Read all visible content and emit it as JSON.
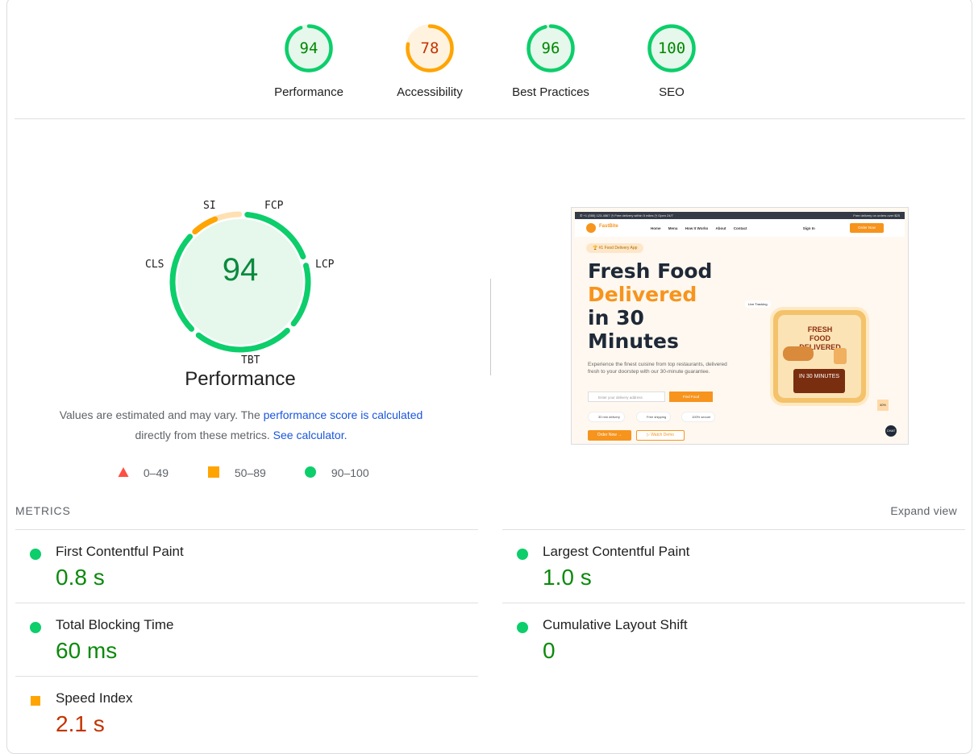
{
  "categories": [
    {
      "label": "Performance",
      "score": "94",
      "value": 94,
      "color": "#0cce6b",
      "text_color": "#008800",
      "fill": "#e6f7ec"
    },
    {
      "label": "Accessibility",
      "score": "78",
      "value": 78,
      "color": "#ffa400",
      "text_color": "#c33300",
      "fill": "#fff3e0"
    },
    {
      "label": "Best Practices",
      "score": "96",
      "value": 96,
      "color": "#0cce6b",
      "text_color": "#008800",
      "fill": "#e6f7ec"
    },
    {
      "label": "SEO",
      "score": "100",
      "value": 100,
      "color": "#0cce6b",
      "text_color": "#008800",
      "fill": "#e6f7ec"
    }
  ],
  "performance": {
    "score": "94",
    "title": "Performance",
    "tags": {
      "si": "SI",
      "fcp": "FCP",
      "lcp": "LCP",
      "tbt": "TBT",
      "cls": "CLS"
    },
    "desc_prefix": "Values are estimated and may vary. The ",
    "desc_link": "performance score is calculated",
    "desc_middle": " directly from these metrics.",
    "desc_link2": "See calculator."
  },
  "legend": [
    {
      "range": "0–49",
      "shape": "triangle",
      "color": "#ff4e42"
    },
    {
      "range": "50–89",
      "shape": "square",
      "color": "#ffa400"
    },
    {
      "range": "90–100",
      "shape": "circle",
      "color": "#0cce6b"
    }
  ],
  "screenshot": {
    "topbar": "✆ +1 (555) 123-4567   ◷ Free delivery within 5 miles   ◷ Open 24/7",
    "topbar_right": "Free delivery on orders over $25",
    "brand": "FastBite",
    "nav": [
      "Home",
      "Menu",
      "How It Works",
      "About",
      "Contact"
    ],
    "sign_in": "Sign In",
    "order_btn": "Order Now",
    "pill": "🏆 #1 Food Delivery App",
    "headline_1": "Fresh Food",
    "headline_2": "Delivered",
    "headline_3": "in 30",
    "headline_4": "Minutes",
    "subtext": "Experience the finest cuisine from top restaurants, delivered fresh to your doorstep with our 30-minute guarantee.",
    "address_placeholder": "Enter your delivery address",
    "find_btn": "Find Food",
    "chips": [
      "30 min delivery",
      "Free shipping",
      "100% secure"
    ],
    "cta_primary": "Order Now →",
    "cta_secondary": "▷ Watch Demo",
    "card_text": "FRESH FOOD DELIVERED",
    "card_badge": "IN 30 MINUTES",
    "live_tracking": "Live Tracking",
    "chat": "CHAT",
    "badge": "40%"
  },
  "metrics": {
    "heading": "METRICS",
    "expand": "Expand view",
    "items": [
      {
        "title": "First Contentful Paint",
        "value": "0.8 s",
        "status": "pass",
        "color": "#0cce6b"
      },
      {
        "title": "Largest Contentful Paint",
        "value": "1.0 s",
        "status": "pass",
        "color": "#0cce6b"
      },
      {
        "title": "Total Blocking Time",
        "value": "60 ms",
        "status": "pass",
        "color": "#0cce6b"
      },
      {
        "title": "Cumulative Layout Shift",
        "value": "0",
        "status": "pass",
        "color": "#0cce6b"
      },
      {
        "title": "Speed Index",
        "value": "2.1 s",
        "status": "average",
        "color": "#ffa400"
      }
    ]
  }
}
